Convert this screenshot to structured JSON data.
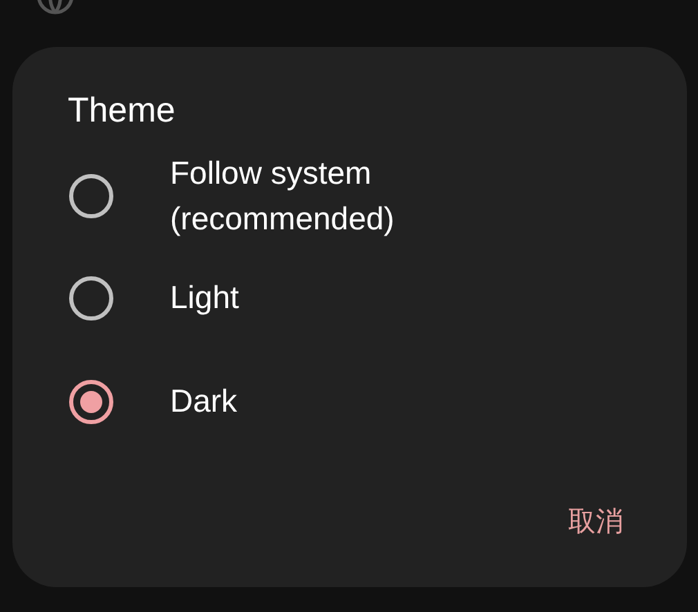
{
  "dialog": {
    "title": "Theme",
    "options": [
      {
        "label": "Follow system (recommended)",
        "selected": false
      },
      {
        "label": "Light",
        "selected": false
      },
      {
        "label": "Dark",
        "selected": true
      }
    ],
    "buttons": [
      "取消"
    ]
  }
}
